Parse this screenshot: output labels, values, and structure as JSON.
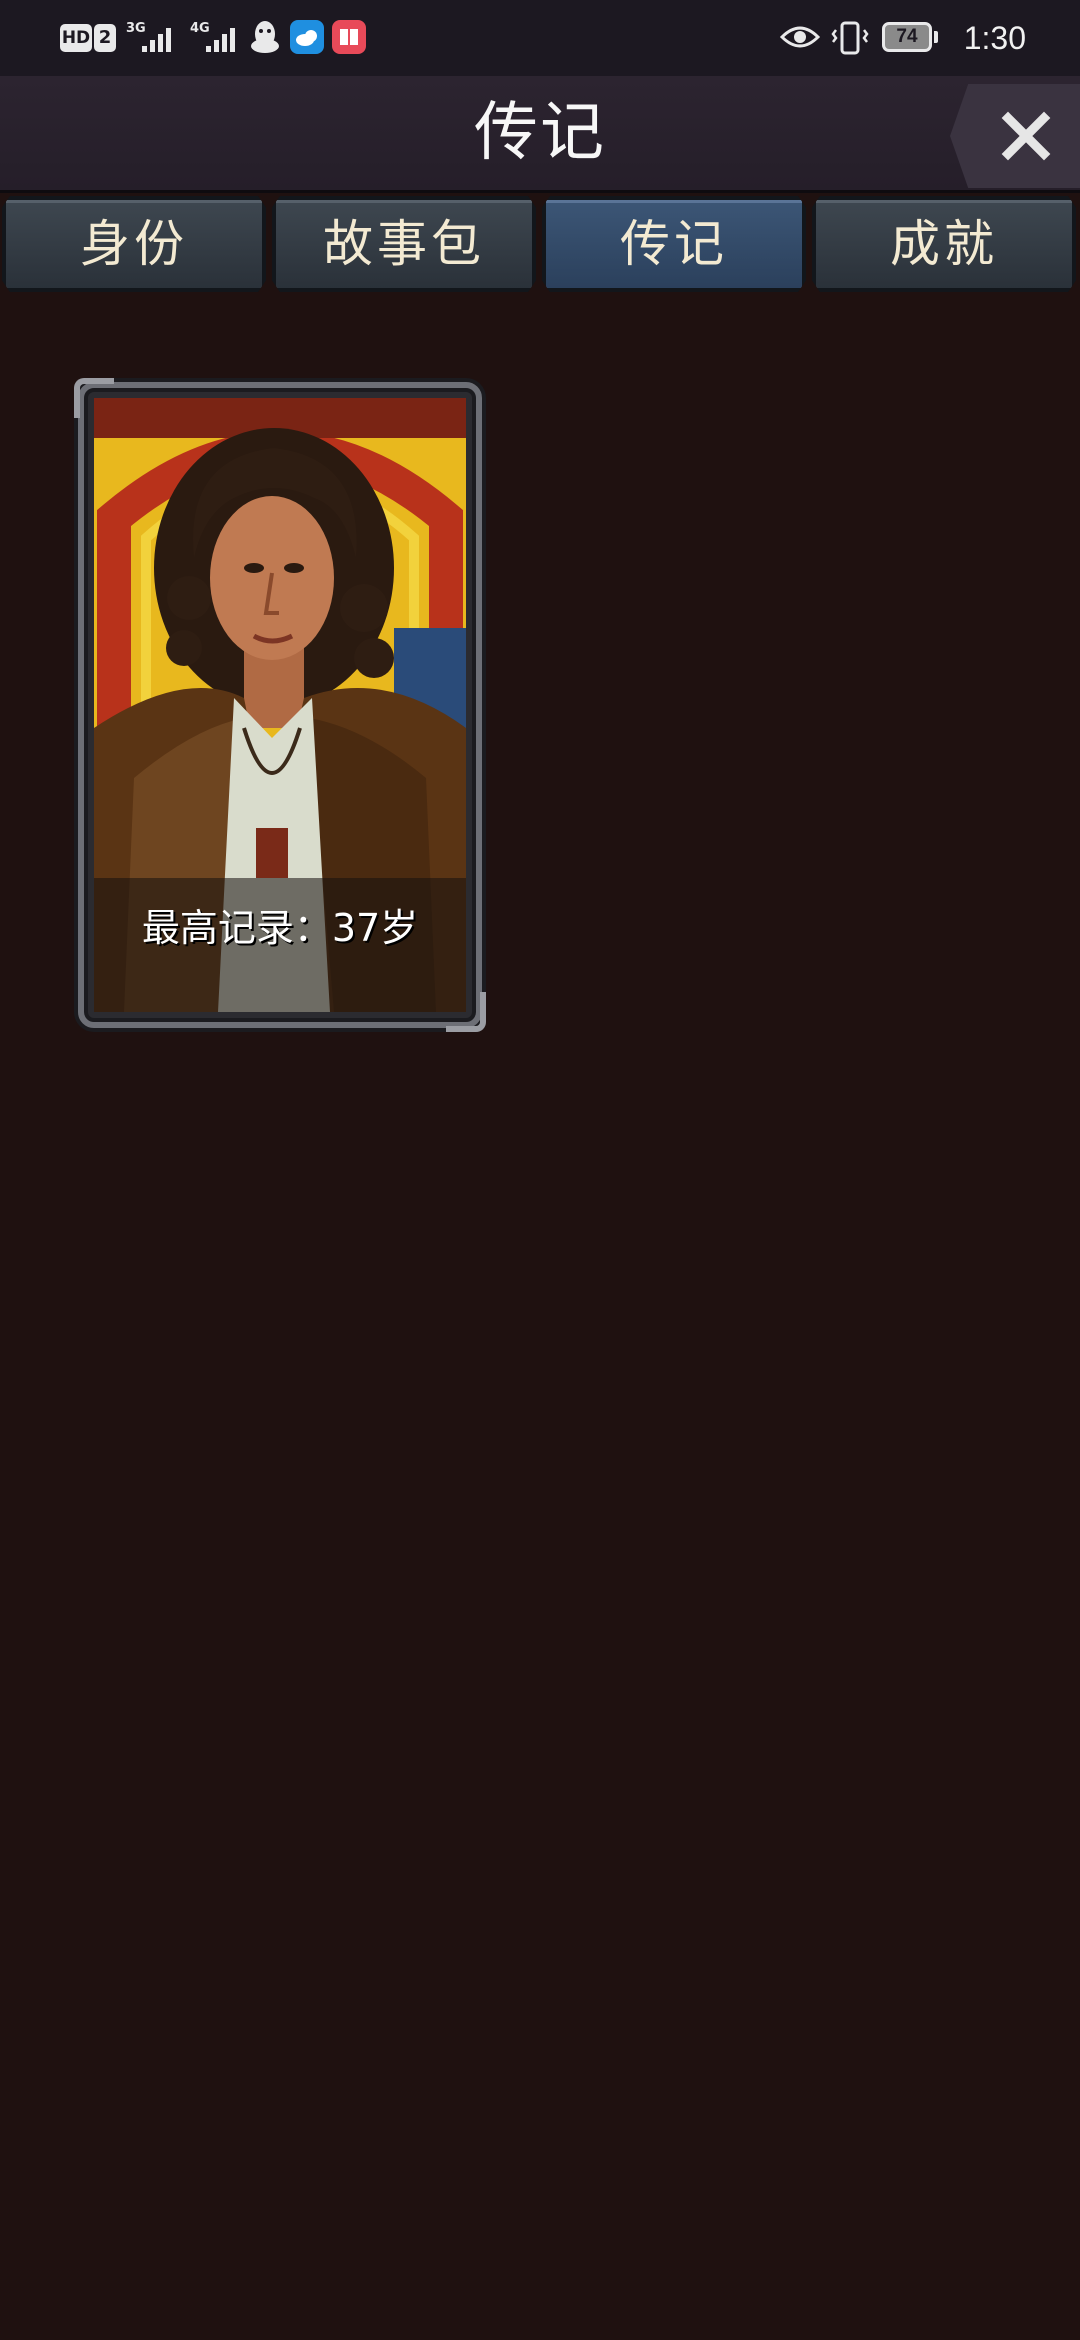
{
  "status_bar": {
    "hd_label": "HD",
    "hd_sim": "2",
    "net1": "3G",
    "net2": "4G",
    "battery": "74",
    "time": "1:30",
    "icons": [
      "qq-penguin-icon",
      "weather-cloud-icon",
      "book-app-icon",
      "eye-icon",
      "vibrate-icon"
    ]
  },
  "header": {
    "title": "传记",
    "close_icon": "close-icon"
  },
  "tabs": [
    {
      "label": "身份",
      "active": false
    },
    {
      "label": "故事包",
      "active": false
    },
    {
      "label": "传记",
      "active": true
    },
    {
      "label": "成就",
      "active": false
    }
  ],
  "card": {
    "caption": "最高记录：37岁",
    "portrait": "portrait-of-curly-haired-young-man"
  },
  "colors": {
    "background": "#1f1110",
    "title_bar": "#2c2430",
    "tab": "#3e4750",
    "tab_active": "#3c5676",
    "tab_text": "#f3ead2",
    "card_frame": "#6d6f76",
    "portrait_bg": "#e2b21f"
  }
}
